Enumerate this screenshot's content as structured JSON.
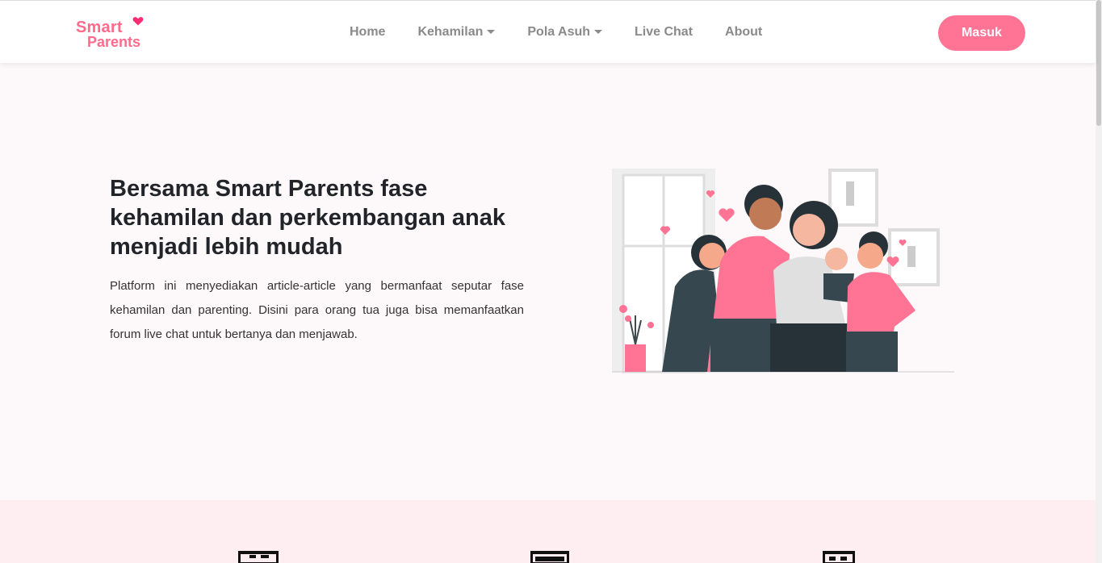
{
  "brand": {
    "line1": "Smart",
    "line2": "Parents"
  },
  "nav": {
    "home": "Home",
    "kehamilan": "Kehamilan",
    "pola_asuh": "Pola Asuh",
    "live_chat": "Live Chat",
    "about": "About"
  },
  "auth": {
    "login_label": "Masuk"
  },
  "hero": {
    "title": "Bersama Smart Parents fase kehamilan dan perkembangan anak menjadi lebih mudah",
    "description": "Platform ini menyediakan article-article yang bermanfaat seputar fase kehamilan dan parenting. Disini para orang tua juga bisa memanfaatkan forum live chat untuk bertanya dan menjawab."
  },
  "colors": {
    "accent": "#ff7494",
    "brand": "#ff6b8a",
    "hero_bg": "#fdf8f9",
    "features_bg": "#ffeef1"
  },
  "icons": [
    "heart-icon",
    "article-icon",
    "news-icon",
    "chat-icon"
  ]
}
